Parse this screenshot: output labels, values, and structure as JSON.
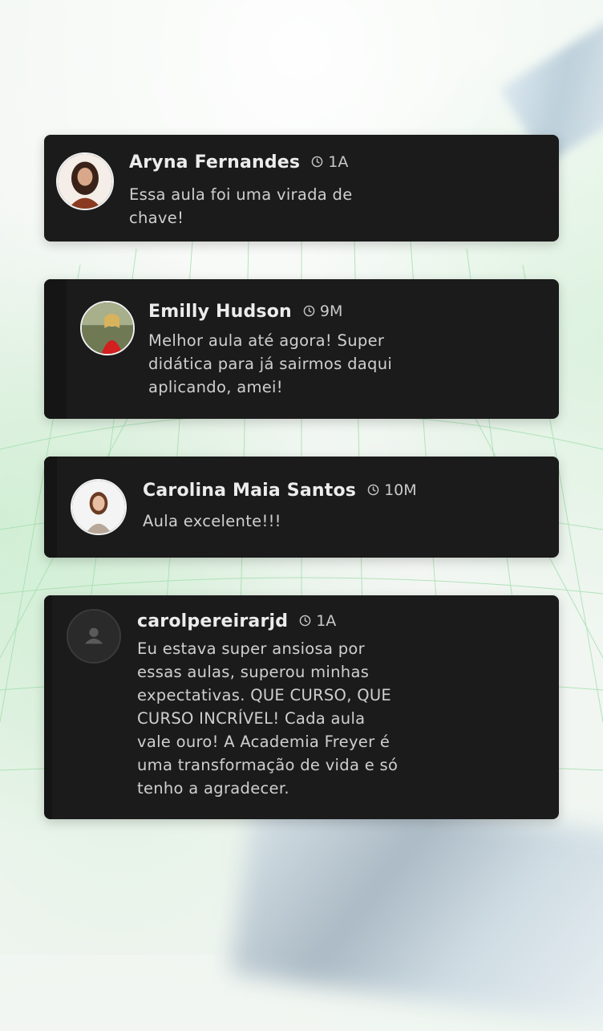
{
  "comments": [
    {
      "author": "Aryna Fernandes",
      "time": "1A",
      "avatar_icon": "user-photo-avatar",
      "text_lines": [
        "Essa aula foi uma virada de",
        "chave!"
      ]
    },
    {
      "author": "Emilly Hudson",
      "time": "9M",
      "avatar_icon": "user-photo-avatar",
      "text_lines": [
        "Melhor aula até agora! Super",
        "didática para já sairmos daqui",
        "aplicando, amei!"
      ]
    },
    {
      "author": "Carolina Maia Santos",
      "time": "10M",
      "avatar_icon": "user-photo-avatar",
      "text_lines": [
        "Aula excelente!!!"
      ]
    },
    {
      "author": "carolpereirarjd",
      "time": "1A",
      "avatar_icon": "default-user-avatar",
      "text_lines": [
        "Eu estava super ansiosa por",
        "essas aulas, superou minhas",
        "expectativas. QUE CURSO, QUE",
        "CURSO INCRÍVEL! Cada aula",
        "vale ouro! A Academia Freyer é",
        "uma transformação de vida e só",
        "tenho a agradecer."
      ]
    }
  ],
  "colors": {
    "card_bg": "#1b1b1b",
    "name_text": "#ececec",
    "body_text": "#cfcfcf",
    "grid_line": "#9fdca9"
  }
}
